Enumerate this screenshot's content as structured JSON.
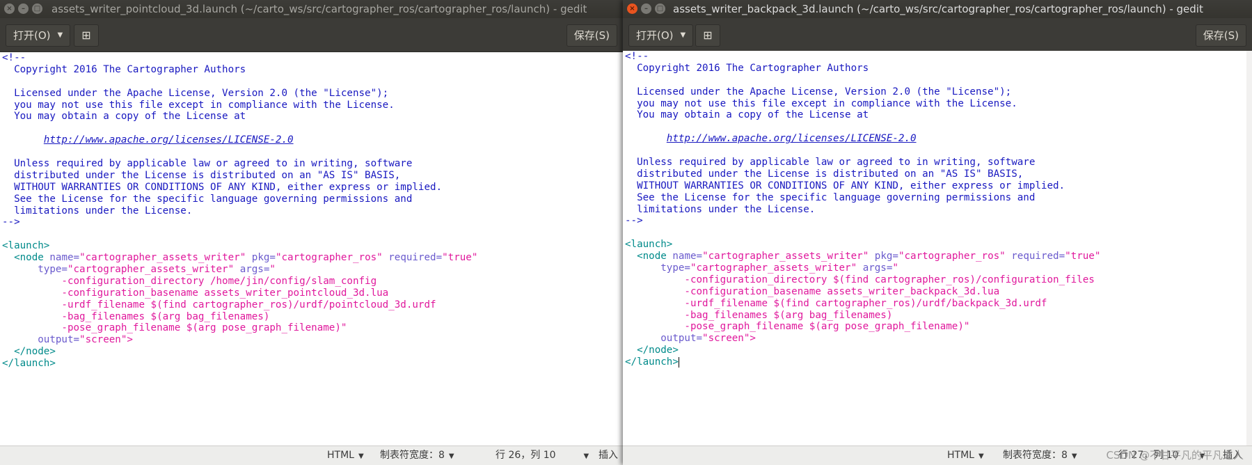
{
  "left_window": {
    "title": "assets_writer_pointcloud_3d.launch (~/carto_ws/src/cartographer_ros/cartographer_ros/launch) - gedit",
    "toolbar": {
      "open_label": "打开(O)",
      "save_label": "保存(S)"
    },
    "status": {
      "language": "HTML",
      "tab_width": "制表符宽度：8",
      "cursor_pos": "行 26，列 10",
      "insert_mode": "插入"
    },
    "code": {
      "comment_open": "<!--",
      "copyright": "  Copyright 2016 The Cartographer Authors",
      "lic1": "  Licensed under the Apache License, Version 2.0 (the \"License\");",
      "lic2": "  you may not use this file except in compliance with the License.",
      "lic3": "  You may obtain a copy of the License at",
      "url": "http://www.apache.org/licenses/LICENSE-2.0",
      "lic4": "  Unless required by applicable law or agreed to in writing, software",
      "lic5": "  distributed under the License is distributed on an \"AS IS\" BASIS,",
      "lic6": "  WITHOUT WARRANTIES OR CONDITIONS OF ANY KIND, either express or implied.",
      "lic7": "  See the License for the specific language governing permissions and",
      "lic8": "  limitations under the License.",
      "comment_close": "-->",
      "launch_open": "<launch>",
      "node_tag": "<node",
      "name_attr": "name=",
      "name_val": "\"cartographer_assets_writer\"",
      "pkg_attr": "pkg=",
      "pkg_val": "\"cartographer_ros\"",
      "req_attr": "required=",
      "req_val": "\"true\"",
      "type_attr": "type=",
      "type_val": "\"cartographer_assets_writer\"",
      "args_attr": "args=",
      "args_quote": "\"",
      "arg1": "-configuration_directory /home/jin/config/slam_config",
      "arg2": "-configuration_basename assets_writer_pointcloud_3d.lua",
      "arg3": "-urdf_filename $(find cartographer_ros)/urdf/pointcloud_3d.urdf",
      "arg4": "-bag_filenames $(arg bag_filenames)",
      "arg5": "-pose_graph_filename $(arg pose_graph_filename)\"",
      "output_attr": "output=",
      "output_val": "\"screen\">",
      "node_close": "</node>",
      "launch_close": "</launch>"
    }
  },
  "right_window": {
    "title": "assets_writer_backpack_3d.launch (~/carto_ws/src/cartographer_ros/cartographer_ros/launch) - gedit",
    "toolbar": {
      "open_label": "打开(O)",
      "save_label": "保存(S)"
    },
    "status": {
      "language": "HTML",
      "tab_width": "制表符宽度：8",
      "cursor_pos": "行 27，列 10",
      "insert_mode": "插入"
    },
    "code": {
      "comment_open": "<!--",
      "copyright": "  Copyright 2016 The Cartographer Authors",
      "lic1": "  Licensed under the Apache License, Version 2.0 (the \"License\");",
      "lic2": "  you may not use this file except in compliance with the License.",
      "lic3": "  You may obtain a copy of the License at",
      "url": "http://www.apache.org/licenses/LICENSE-2.0",
      "lic4": "  Unless required by applicable law or agreed to in writing, software",
      "lic5": "  distributed under the License is distributed on an \"AS IS\" BASIS,",
      "lic6": "  WITHOUT WARRANTIES OR CONDITIONS OF ANY KIND, either express or implied.",
      "lic7": "  See the License for the specific language governing permissions and",
      "lic8": "  limitations under the License.",
      "comment_close": "-->",
      "launch_open": "<launch>",
      "node_tag": "<node",
      "name_attr": "name=",
      "name_val": "\"cartographer_assets_writer\"",
      "pkg_attr": "pkg=",
      "pkg_val": "\"cartographer_ros\"",
      "req_attr": "required=",
      "req_val": "\"true\"",
      "type_attr": "type=",
      "type_val": "\"cartographer_assets_writer\"",
      "args_attr": "args=",
      "args_quote": "\"",
      "arg1": "-configuration_directory $(find cartographer_ros)/configuration_files",
      "arg2": "-configuration_basename assets_writer_backpack_3d.lua",
      "arg3": "-urdf_filename $(find cartographer_ros)/urdf/backpack_3d.urdf",
      "arg4": "-bag_filenames $(arg bag_filenames)",
      "arg5": "-pose_graph_filename $(arg pose_graph_filename)\"",
      "output_attr": "output=",
      "output_val": "\"screen\">",
      "node_close": "</node>",
      "launch_close": "</launch>"
    }
  },
  "watermark": "CSDN @不甘平凡的平凡之人"
}
